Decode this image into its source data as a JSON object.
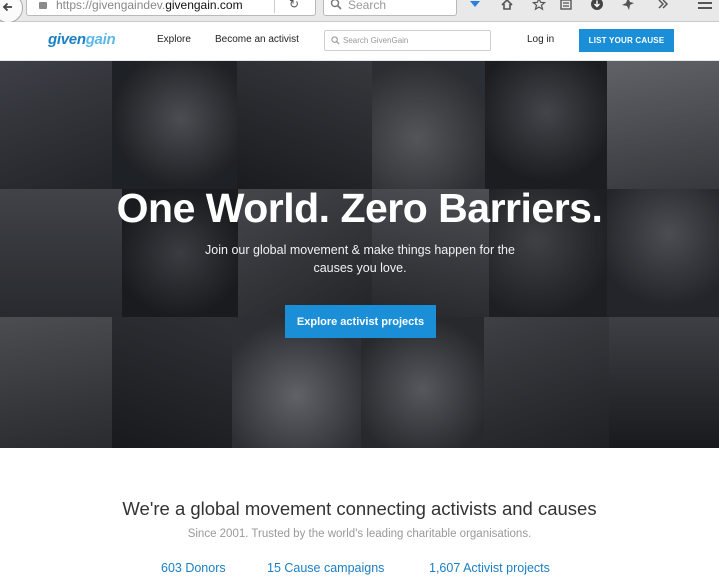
{
  "browser": {
    "url_prefix": "https://givengaindev.",
    "url_domain": "givengain.com",
    "search_placeholder": "Search"
  },
  "header": {
    "logo_part1": "given",
    "logo_part2": "gain",
    "nav": [
      "Explore",
      "Become an activist"
    ],
    "search_placeholder": "Search GivenGain",
    "login": "Log in",
    "cta": "LIST YOUR CAUSE"
  },
  "hero": {
    "title": "One World. Zero Barriers.",
    "subtitle": "Join our global movement & make things happen for the causes you love.",
    "button": "Explore activist projects"
  },
  "stats": {
    "heading": "We're a global movement connecting activists and causes",
    "subheading": "Since 2001. Trusted by the world's leading charitable organisations.",
    "items": [
      "603 Donors",
      "15 Cause campaigns",
      "1,607 Activist projects"
    ]
  },
  "colors": {
    "brand_blue": "#1a8fd8",
    "link_blue": "#1a7fc4"
  }
}
